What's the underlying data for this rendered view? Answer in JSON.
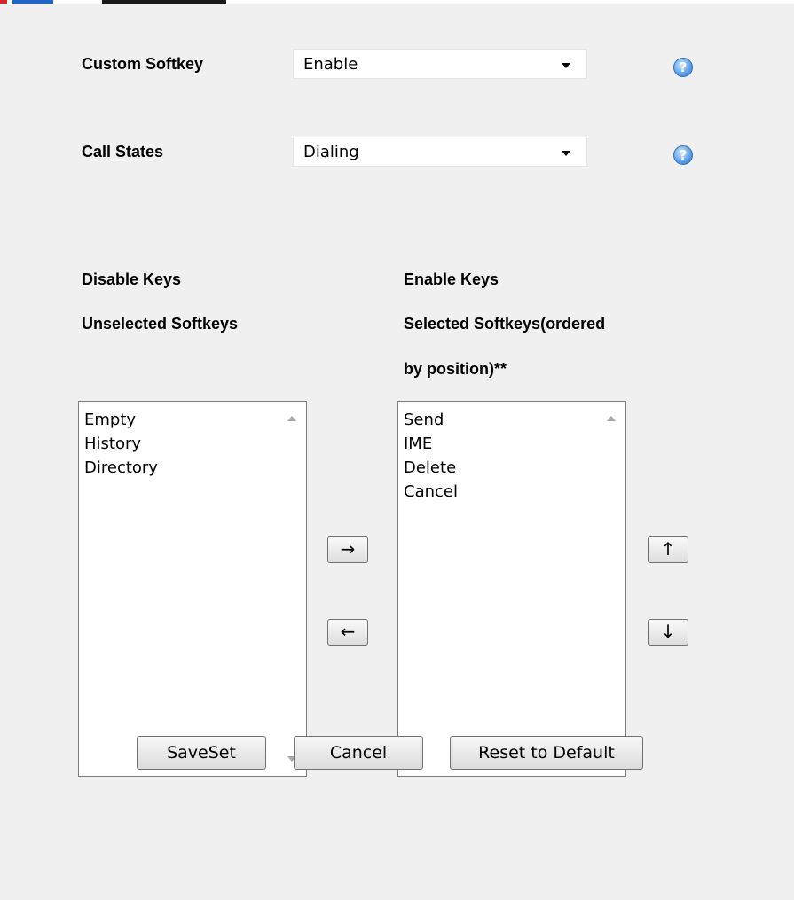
{
  "form": {
    "custom_softkey": {
      "label": "Custom Softkey",
      "value": "Enable"
    },
    "call_states": {
      "label": "Call States",
      "value": "Dialing"
    }
  },
  "help_glyph": "?",
  "disable_keys": {
    "heading": "Disable Keys",
    "subheading": "Unselected Softkeys",
    "items": [
      "Empty",
      "History",
      "Directory"
    ]
  },
  "enable_keys": {
    "heading": "Enable Keys",
    "subheading_line1": "Selected Softkeys(ordered",
    "subheading_line2": "by position)**",
    "items": [
      "Send",
      "IME",
      "Delete",
      "Cancel"
    ]
  },
  "transfer": {
    "move_right": "→",
    "move_left": "←"
  },
  "order": {
    "move_up": "↑",
    "move_down": "↓"
  },
  "actions": {
    "save": "SaveSet",
    "cancel": "Cancel",
    "reset": "Reset to Default"
  },
  "colors": {
    "accent_blue": "#1f64c8",
    "accent_red": "#d9262e"
  }
}
